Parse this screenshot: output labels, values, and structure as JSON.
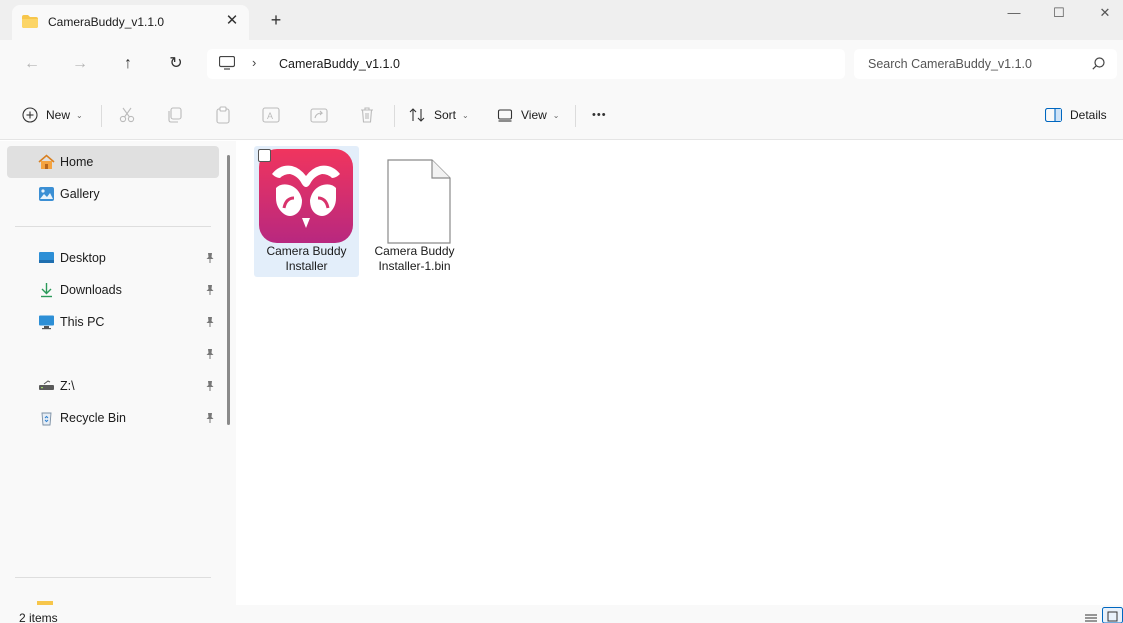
{
  "window": {
    "tab_title": "CameraBuddy_v1.1.0",
    "tab_close": "✕",
    "new_tab": "+",
    "minimize": "—",
    "maximize": "☐",
    "close": "✕"
  },
  "navigation": {
    "back": "←",
    "forward": "→",
    "up": "↑",
    "refresh": "↻"
  },
  "address_bar": {
    "separator": "›",
    "breadcrumb": "CameraBuddy_v1.1.0"
  },
  "search": {
    "placeholder": "Search CameraBuddy_v1.1.0"
  },
  "command_bar": {
    "new_label": "New",
    "sort_label": "Sort",
    "view_label": "View",
    "more_label": "•••",
    "details_label": "Details",
    "dropdown_glyph": "⌄"
  },
  "sidebar": {
    "top_items": [
      {
        "label": "Home",
        "icon": "home-icon",
        "selected": true
      },
      {
        "label": "Gallery",
        "icon": "gallery-icon",
        "selected": false
      }
    ],
    "quick_access": [
      {
        "label": "Desktop",
        "icon": "desktop-icon",
        "pinned": true
      },
      {
        "label": "Downloads",
        "icon": "downloads-icon",
        "pinned": true
      },
      {
        "label": "This PC",
        "icon": "this-pc-icon",
        "pinned": true
      },
      {
        "label": "",
        "icon": "",
        "pinned": true
      },
      {
        "label": "Z:\\",
        "icon": "drive-icon",
        "pinned": true
      },
      {
        "label": "Recycle Bin",
        "icon": "recycle-bin-icon",
        "pinned": true
      }
    ]
  },
  "files": [
    {
      "name": "Camera Buddy Installer",
      "type": "app",
      "selected": true
    },
    {
      "name": "Camera Buddy Installer-1.bin",
      "type": "generic-file",
      "selected": false
    }
  ],
  "status": {
    "item_count": "2 items"
  },
  "colors": {
    "app_icon_top": "#f0355e",
    "app_icon_bottom": "#b8287f",
    "selection": "#e3eefa",
    "folder_yellow": "#f7c64b",
    "accent_blue": "#0067c0"
  }
}
